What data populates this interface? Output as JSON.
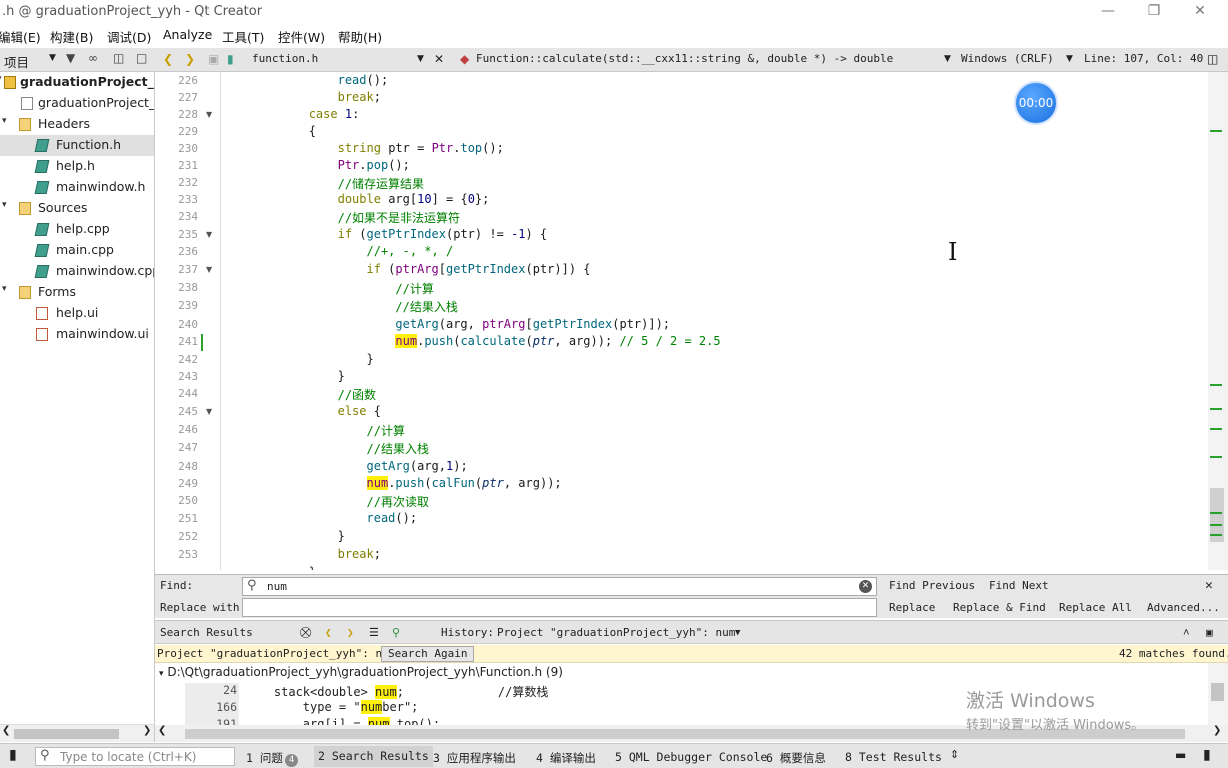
{
  "window": {
    "title": ".h @ graduationProject_yyh - Qt Creator"
  },
  "menu": [
    "编辑(E)",
    "构建(B)",
    "调试(D)",
    "Analyze",
    "工具(T)",
    "控件(W)",
    "帮助(H)"
  ],
  "left_toolbar": {
    "combo": "项目"
  },
  "project_tree": [
    {
      "label": "graduationProject_yyh",
      "bold": true,
      "icon": "project-icon"
    },
    {
      "label": "graduationProject_yyh.pro",
      "icon": "pro-file-icon"
    },
    {
      "label": "Headers",
      "icon": "headers-folder-icon"
    },
    {
      "label": "Function.h",
      "icon": "header-file-icon",
      "selected": true
    },
    {
      "label": "help.h",
      "icon": "header-file-icon"
    },
    {
      "label": "mainwindow.h",
      "icon": "header-file-icon"
    },
    {
      "label": "Sources",
      "icon": "sources-folder-icon"
    },
    {
      "label": "help.cpp",
      "icon": "source-file-icon"
    },
    {
      "label": "main.cpp",
      "icon": "source-file-icon"
    },
    {
      "label": "mainwindow.cpp",
      "icon": "source-file-icon"
    },
    {
      "label": "Forms",
      "icon": "forms-folder-icon"
    },
    {
      "label": "help.ui",
      "icon": "ui-file-icon"
    },
    {
      "label": "mainwindow.ui",
      "icon": "ui-file-icon"
    }
  ],
  "editor_toolbar": {
    "file": "function.h",
    "symbol": "Function::calculate(std::__cxx11::string &, double *) -> double",
    "line_ending": "Windows (CRLF)",
    "position": "Line: 107, Col: 40"
  },
  "code_lines": [
    "226",
    "227",
    "228",
    "229",
    "230",
    "231",
    "232",
    "233",
    "234",
    "235",
    "236",
    "237",
    "238",
    "239",
    "240",
    "241",
    "242",
    "243",
    "244",
    "245",
    "246",
    "247",
    "248",
    "249",
    "250",
    "251",
    "252",
    "253"
  ],
  "code": {
    "l226": "read",
    "l227": "break",
    "l228_kw": "case",
    "l228_num": "1",
    "l230_type": "string",
    "l230_var": "ptr",
    "l230_obj": "Ptr",
    "l230_fn": "top",
    "l231_obj": "Ptr",
    "l231_fn": "pop",
    "l232": "//储存运算结果",
    "l233_type": "double",
    "l233_var": "arg",
    "l233_size": "10",
    "l233_init": "0",
    "l234": "//如果不是非法运算符",
    "l235_kw": "if",
    "l235_fn": "getPtrIndex",
    "l235_arg": "ptr",
    "l235_num": "-1",
    "l236": "//+, -, *, /",
    "l237_kw": "if",
    "l237_obj": "ptrArg",
    "l237_fn": "getPtrIndex",
    "l237_arg": "ptr",
    "l238": "//计算",
    "l239": "//结果入栈",
    "l240_fn": "getArg",
    "l240_a1": "arg",
    "l240_a2": "ptrArg",
    "l240_fn2": "getPtrIndex",
    "l240_a3": "ptr",
    "l241_hl": "num",
    "l241_fn": "push",
    "l241_fn2": "calculate",
    "l241_a1": "ptr",
    "l241_a2": "arg",
    "l241_cm": "// 5 / 2 = 2.5",
    "l244": "//函数",
    "l245_kw": "else",
    "l246": "//计算",
    "l247": "//结果入栈",
    "l248_fn": "getArg",
    "l248_a1": "arg",
    "l248_num": "1",
    "l249_hl": "num",
    "l249_fn": "push",
    "l249_fn2": "calFun",
    "l249_a1": "ptr",
    "l249_a2": "arg",
    "l250": "//再次读取",
    "l251": "read",
    "l253": "break"
  },
  "timer": "00:00",
  "find": {
    "find_label": "Find:",
    "replace_label": "Replace with:",
    "query": "num",
    "replace_value": "",
    "find_previous": "Find Previous",
    "find_next": "Find Next",
    "replace": "Replace",
    "replace_find": "Replace & Find",
    "replace_all": "Replace All",
    "advanced": "Advanced..."
  },
  "search_results": {
    "title": "Search Results",
    "history_label": "History:",
    "history_value": "Project \"graduationProject_yyh\": num",
    "scope": "Project \"graduationProject_yyh\": num",
    "search_again": "Search Again",
    "match_count": "42 matches found.",
    "file_path": "D:\\Qt\\graduationProject_yyh\\graduationProject_yyh\\Function.h (9)",
    "rows": [
      {
        "line": "24",
        "pre": "    stack<double> ",
        "hit": "num",
        "post": ";             //算数栈"
      },
      {
        "line": "166",
        "pre": "        type = \"",
        "hit": "num",
        "post": "ber\";"
      },
      {
        "line": "191",
        "pre": "        arg[i] = ",
        "hit": "num",
        "post": ".top();"
      }
    ]
  },
  "watermark": {
    "line1": "激活 Windows",
    "line2": "转到\"设置\"以激活 Windows。"
  },
  "statusbar": {
    "locate_placeholder": "Type to locate (Ctrl+K)",
    "tabs": [
      {
        "label": "1 问题",
        "badge": "4"
      },
      {
        "label": "2 Search Results",
        "active": true
      },
      {
        "label": "3 应用程序输出"
      },
      {
        "label": "4 编译输出"
      },
      {
        "label": "5 QML Debugger Console"
      },
      {
        "label": "6 概要信息"
      },
      {
        "label": "8 Test Results"
      }
    ]
  },
  "colors": {
    "highlight": "#ffef0b",
    "keyword": "#7f7f00",
    "comment": "#008000",
    "accent": "#1a6fe0"
  }
}
